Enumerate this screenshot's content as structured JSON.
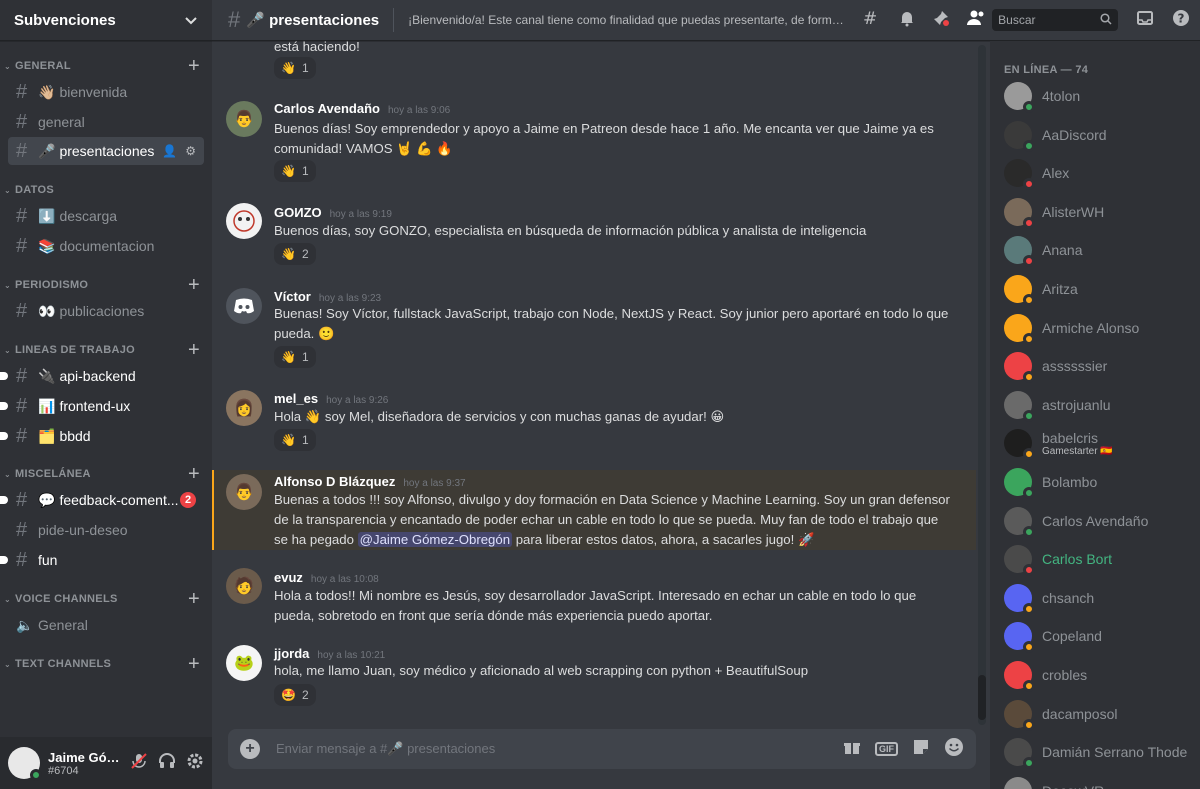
{
  "server": {
    "name": "Subvenciones"
  },
  "categories": [
    {
      "label": "GENERAL"
    },
    {
      "label": "DATOS"
    },
    {
      "label": "PERIODISMO"
    },
    {
      "label": "LINEAS DE TRABAJO"
    },
    {
      "label": "MISCELÁNEA"
    },
    {
      "label": "VOICE CHANNELS"
    },
    {
      "label": "TEXT CHANNELS"
    }
  ],
  "channels": [
    {
      "emoji": "👋🏼",
      "label": "bienvenida"
    },
    {
      "emoji": "",
      "label": "general"
    },
    {
      "emoji": "🎤",
      "label": "presentaciones"
    },
    {
      "emoji": "⬇️",
      "label": "descarga"
    },
    {
      "emoji": "📚",
      "label": "documentacion"
    },
    {
      "emoji": "👀",
      "label": "publicaciones"
    },
    {
      "emoji": "🔌",
      "label": "api-backend"
    },
    {
      "emoji": "📊",
      "label": "frontend-ux"
    },
    {
      "emoji": "🗂️",
      "label": "bbdd"
    },
    {
      "emoji": "💬",
      "label": "feedback-coment...",
      "badge": "2"
    },
    {
      "emoji": "",
      "label": "pide-un-deseo"
    },
    {
      "emoji": "",
      "label": "fun"
    },
    {
      "emoji": "",
      "label": "General"
    }
  ],
  "user": {
    "name": "Jaime Góme...",
    "tag": "#6704"
  },
  "header": {
    "channel": "🎤 presentaciones",
    "topic": "¡Bienvenido/a! Este canal tiene como finalidad que puedas presentarte, de forma br...",
    "search_placeholder": "Buscar"
  },
  "messages": [
    {
      "author": "",
      "time": "",
      "body": "está haciendo!",
      "reaction": {
        "emoji": "👋",
        "count": "1"
      }
    },
    {
      "author": "Carlos Avendaño",
      "time": "hoy a las 9:06",
      "body": "Buenos días! Soy emprendedor y apoyo a Jaime en Patreon desde hace 1 año. Me encanta ver que Jaime ya es comunidad! VAMOS 🤘 💪 🔥",
      "reaction": {
        "emoji": "👋",
        "count": "1"
      }
    },
    {
      "author": "GOИZO",
      "time": "hoy a las 9:19",
      "body": "Buenos días, soy GONZO, especialista en búsqueda de información pública y analista de inteligencia",
      "reaction": {
        "emoji": "👋",
        "count": "2"
      }
    },
    {
      "author": "Víctor",
      "time": "hoy a las 9:23",
      "body": "Buenas! Soy Víctor, fullstack JavaScript, trabajo con Node, NextJS y React. Soy junior pero aportaré en todo lo que pueda. 🙂",
      "reaction": {
        "emoji": "👋",
        "count": "1"
      }
    },
    {
      "author": "mel_es",
      "time": "hoy a las 9:26",
      "body": "Hola 👋 soy Mel, diseñadora de servicios y con muchas ganas de ayudar! 😀",
      "reaction": {
        "emoji": "👋",
        "count": "1"
      }
    },
    {
      "author": "Alfonso D Blázquez",
      "time": "hoy a las 9:37",
      "body_a": "Buenas a todos !!! soy Alfonso, divulgo y doy formación en Data Science y Machine Learning. Soy un gran defensor de la transparencia y encantado de poder echar un cable en todo lo que se pueda. Muy fan de todo el trabajo que se ha pegado ",
      "mention": "@Jaime Gómez-Obregón",
      "body_b": " para liberar estos datos, ahora, a sacarles jugo! 🚀"
    },
    {
      "author": "evuz",
      "time": "hoy a las 10:08",
      "body": "Hola a todos!! Mi nombre es Jesús, soy desarrollador JavaScript. Interesado en echar un cable en todo lo que pueda, sobretodo en front que sería dónde más experiencia puedo aportar."
    },
    {
      "author": "jjorda",
      "time": "hoy a las 10:21",
      "body": "hola, me llamo Juan, soy médico y aficionado al web scrapping con python + BeautifulSoup",
      "reaction": {
        "emoji": "🤩",
        "count": "2"
      }
    }
  ],
  "composer": {
    "placeholder": "Enviar mensaje a #🎤 presentaciones",
    "gif_label": "GIF"
  },
  "members": {
    "title": "EN LÍNEA — 74",
    "list": [
      {
        "name": "4tolon",
        "color": "#8e9297",
        "status": "#3ba55d"
      },
      {
        "name": "AaDiscord",
        "color": "#8e9297",
        "status": "#3ba55d"
      },
      {
        "name": "Alex",
        "color": "#8e9297",
        "status": "#ed4245"
      },
      {
        "name": "AlisterWH",
        "color": "#8e9297",
        "status": "#ed4245"
      },
      {
        "name": "Anana",
        "color": "#8e9297",
        "status": "#ed4245"
      },
      {
        "name": "Aritza",
        "color": "#8e9297",
        "status": "#faa61a"
      },
      {
        "name": "Armiche Alonso",
        "color": "#8e9297",
        "status": "#faa61a"
      },
      {
        "name": "assssssier",
        "color": "#8e9297",
        "status": "#faa61a"
      },
      {
        "name": "astrojuanlu",
        "color": "#8e9297",
        "status": "#3ba55d"
      },
      {
        "name": "babelcris",
        "color": "#8e9297",
        "status": "#faa61a",
        "sub": "Gamestarter 🇪🇸"
      },
      {
        "name": "Bolambo",
        "color": "#8e9297",
        "status": "#3ba55d"
      },
      {
        "name": "Carlos Avendaño",
        "color": "#8e9297",
        "status": "#3ba55d"
      },
      {
        "name": "Carlos Bort",
        "color": "#43b581",
        "status": "#ed4245"
      },
      {
        "name": "chsanch",
        "color": "#8e9297",
        "status": "#faa61a"
      },
      {
        "name": "Copeland",
        "color": "#8e9297",
        "status": "#faa61a"
      },
      {
        "name": "crobles",
        "color": "#8e9297",
        "status": "#faa61a"
      },
      {
        "name": "dacamposol",
        "color": "#8e9297",
        "status": "#faa61a"
      },
      {
        "name": "Damián Serrano Thode",
        "color": "#8e9297",
        "status": "#3ba55d"
      },
      {
        "name": "DecowVR",
        "color": "#8e9297",
        "status": "#3ba55d"
      }
    ]
  }
}
